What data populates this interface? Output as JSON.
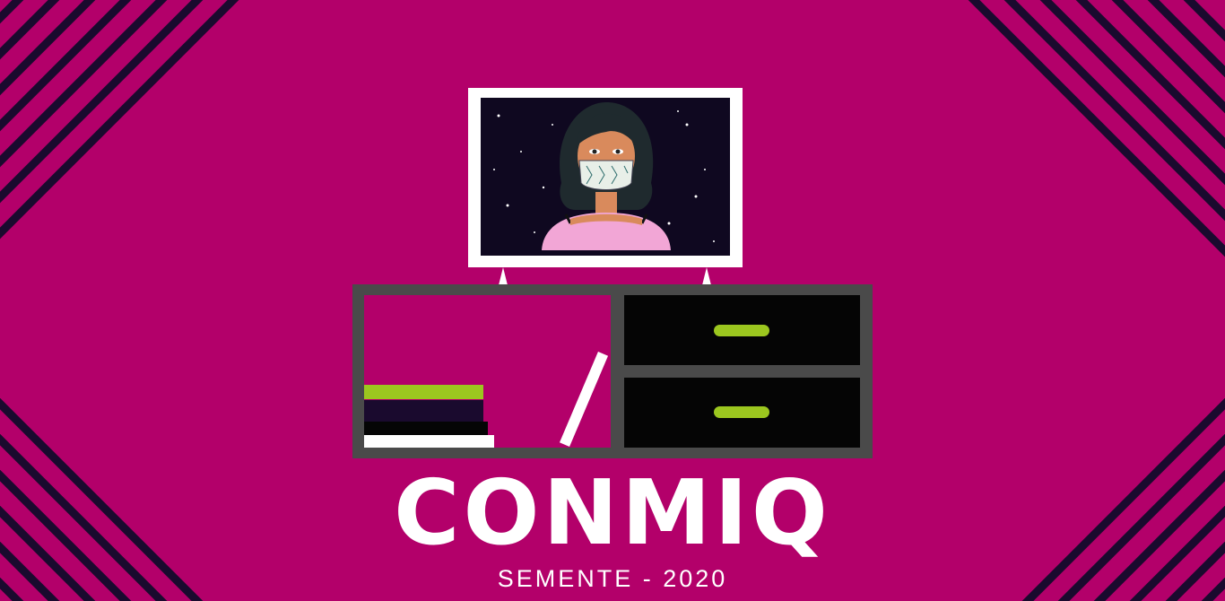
{
  "title": "CONMIQ",
  "subtitle": "SEMENTE - 2020",
  "colors": {
    "background": "#b3006a",
    "stripe": "#1a0a2e",
    "cabinet": "#4a4a4a",
    "accent_green": "#9cc71f",
    "screen": "#0f0820",
    "white": "#ffffff"
  },
  "illustration": {
    "tv_subject": "woman-with-patterned-face-mask",
    "icons": [
      "tv-icon",
      "cabinet-icon",
      "books-icon",
      "drawer-handle-icon"
    ]
  }
}
